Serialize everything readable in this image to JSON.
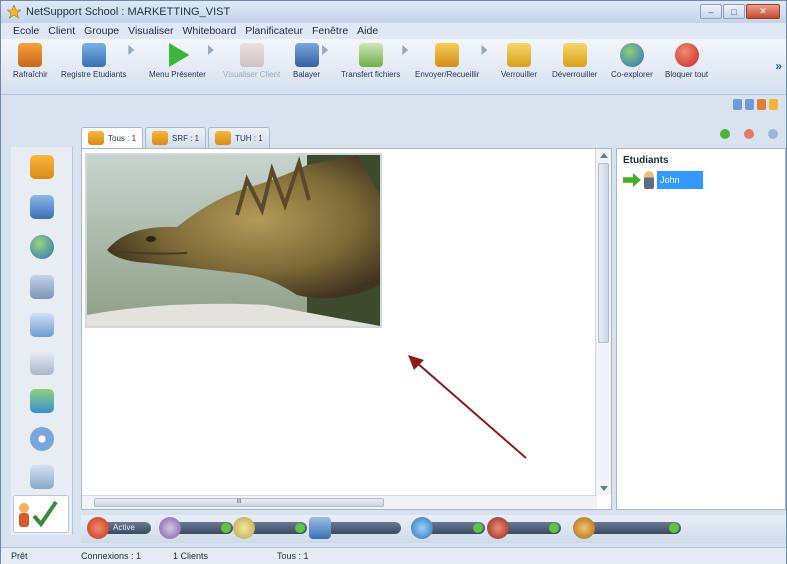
{
  "window": {
    "title": "NetSupport School : MARKETTING_VIST",
    "controls": [
      "minimize",
      "maximize",
      "close"
    ]
  },
  "menu": [
    "Ecole",
    "Client",
    "Groupe",
    "Visualiser",
    "Whiteboard",
    "Planificateur",
    "Fenêtre",
    "Aide"
  ],
  "toolbar": [
    {
      "label": "Rafraîchir",
      "icon": "refresh-icon",
      "enabled": true
    },
    {
      "label": "Registre Etudiants",
      "icon": "student-register-icon",
      "enabled": true
    },
    {
      "label": "Menu Présenter",
      "icon": "present-icon",
      "enabled": true
    },
    {
      "label": "Visualiser Client",
      "icon": "view-client-icon",
      "enabled": false
    },
    {
      "label": "Balayer",
      "icon": "scan-icon",
      "enabled": true
    },
    {
      "label": "Transfert fichiers",
      "icon": "file-transfer-icon",
      "enabled": true
    },
    {
      "label": "Envoyer/Recueillir",
      "icon": "send-collect-icon",
      "enabled": true
    },
    {
      "label": "Verrouiller",
      "icon": "lock-icon",
      "enabled": true
    },
    {
      "label": "Déverrouiller",
      "icon": "unlock-icon",
      "enabled": true
    },
    {
      "label": "Co-explorer",
      "icon": "co-browse-icon",
      "enabled": true
    },
    {
      "label": "Bloquer tout",
      "icon": "block-all-icon",
      "enabled": true
    }
  ],
  "tabs": [
    {
      "label": "Tous : 1",
      "active": true
    },
    {
      "label": "SRF : 1",
      "active": false
    },
    {
      "label": "TUH : 1",
      "active": false
    }
  ],
  "students_panel": {
    "header": "Etudiants",
    "students": [
      {
        "name": "John"
      }
    ]
  },
  "status_strip": {
    "first_pill_label": "Active"
  },
  "statusbar": {
    "ready": "Prêt",
    "connections": "Connexions : 1",
    "clients": "1 Clients",
    "all": "Tous : 1"
  },
  "colors": {
    "accent": "#3399ff",
    "window_bg": "#d9e3ef"
  }
}
